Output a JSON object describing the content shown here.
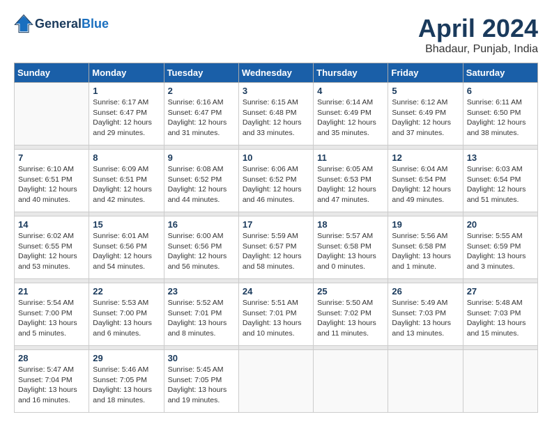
{
  "header": {
    "logo_line1": "General",
    "logo_line2": "Blue",
    "title": "April 2024",
    "subtitle": "Bhadaur, Punjab, India"
  },
  "weekdays": [
    "Sunday",
    "Monday",
    "Tuesday",
    "Wednesday",
    "Thursday",
    "Friday",
    "Saturday"
  ],
  "weeks": [
    [
      {
        "day": "",
        "info": ""
      },
      {
        "day": "1",
        "info": "Sunrise: 6:17 AM\nSunset: 6:47 PM\nDaylight: 12 hours\nand 29 minutes."
      },
      {
        "day": "2",
        "info": "Sunrise: 6:16 AM\nSunset: 6:47 PM\nDaylight: 12 hours\nand 31 minutes."
      },
      {
        "day": "3",
        "info": "Sunrise: 6:15 AM\nSunset: 6:48 PM\nDaylight: 12 hours\nand 33 minutes."
      },
      {
        "day": "4",
        "info": "Sunrise: 6:14 AM\nSunset: 6:49 PM\nDaylight: 12 hours\nand 35 minutes."
      },
      {
        "day": "5",
        "info": "Sunrise: 6:12 AM\nSunset: 6:49 PM\nDaylight: 12 hours\nand 37 minutes."
      },
      {
        "day": "6",
        "info": "Sunrise: 6:11 AM\nSunset: 6:50 PM\nDaylight: 12 hours\nand 38 minutes."
      }
    ],
    [
      {
        "day": "7",
        "info": "Sunrise: 6:10 AM\nSunset: 6:51 PM\nDaylight: 12 hours\nand 40 minutes."
      },
      {
        "day": "8",
        "info": "Sunrise: 6:09 AM\nSunset: 6:51 PM\nDaylight: 12 hours\nand 42 minutes."
      },
      {
        "day": "9",
        "info": "Sunrise: 6:08 AM\nSunset: 6:52 PM\nDaylight: 12 hours\nand 44 minutes."
      },
      {
        "day": "10",
        "info": "Sunrise: 6:06 AM\nSunset: 6:52 PM\nDaylight: 12 hours\nand 46 minutes."
      },
      {
        "day": "11",
        "info": "Sunrise: 6:05 AM\nSunset: 6:53 PM\nDaylight: 12 hours\nand 47 minutes."
      },
      {
        "day": "12",
        "info": "Sunrise: 6:04 AM\nSunset: 6:54 PM\nDaylight: 12 hours\nand 49 minutes."
      },
      {
        "day": "13",
        "info": "Sunrise: 6:03 AM\nSunset: 6:54 PM\nDaylight: 12 hours\nand 51 minutes."
      }
    ],
    [
      {
        "day": "14",
        "info": "Sunrise: 6:02 AM\nSunset: 6:55 PM\nDaylight: 12 hours\nand 53 minutes."
      },
      {
        "day": "15",
        "info": "Sunrise: 6:01 AM\nSunset: 6:56 PM\nDaylight: 12 hours\nand 54 minutes."
      },
      {
        "day": "16",
        "info": "Sunrise: 6:00 AM\nSunset: 6:56 PM\nDaylight: 12 hours\nand 56 minutes."
      },
      {
        "day": "17",
        "info": "Sunrise: 5:59 AM\nSunset: 6:57 PM\nDaylight: 12 hours\nand 58 minutes."
      },
      {
        "day": "18",
        "info": "Sunrise: 5:57 AM\nSunset: 6:58 PM\nDaylight: 13 hours\nand 0 minutes."
      },
      {
        "day": "19",
        "info": "Sunrise: 5:56 AM\nSunset: 6:58 PM\nDaylight: 13 hours\nand 1 minute."
      },
      {
        "day": "20",
        "info": "Sunrise: 5:55 AM\nSunset: 6:59 PM\nDaylight: 13 hours\nand 3 minutes."
      }
    ],
    [
      {
        "day": "21",
        "info": "Sunrise: 5:54 AM\nSunset: 7:00 PM\nDaylight: 13 hours\nand 5 minutes."
      },
      {
        "day": "22",
        "info": "Sunrise: 5:53 AM\nSunset: 7:00 PM\nDaylight: 13 hours\nand 6 minutes."
      },
      {
        "day": "23",
        "info": "Sunrise: 5:52 AM\nSunset: 7:01 PM\nDaylight: 13 hours\nand 8 minutes."
      },
      {
        "day": "24",
        "info": "Sunrise: 5:51 AM\nSunset: 7:01 PM\nDaylight: 13 hours\nand 10 minutes."
      },
      {
        "day": "25",
        "info": "Sunrise: 5:50 AM\nSunset: 7:02 PM\nDaylight: 13 hours\nand 11 minutes."
      },
      {
        "day": "26",
        "info": "Sunrise: 5:49 AM\nSunset: 7:03 PM\nDaylight: 13 hours\nand 13 minutes."
      },
      {
        "day": "27",
        "info": "Sunrise: 5:48 AM\nSunset: 7:03 PM\nDaylight: 13 hours\nand 15 minutes."
      }
    ],
    [
      {
        "day": "28",
        "info": "Sunrise: 5:47 AM\nSunset: 7:04 PM\nDaylight: 13 hours\nand 16 minutes."
      },
      {
        "day": "29",
        "info": "Sunrise: 5:46 AM\nSunset: 7:05 PM\nDaylight: 13 hours\nand 18 minutes."
      },
      {
        "day": "30",
        "info": "Sunrise: 5:45 AM\nSunset: 7:05 PM\nDaylight: 13 hours\nand 19 minutes."
      },
      {
        "day": "",
        "info": ""
      },
      {
        "day": "",
        "info": ""
      },
      {
        "day": "",
        "info": ""
      },
      {
        "day": "",
        "info": ""
      }
    ]
  ]
}
